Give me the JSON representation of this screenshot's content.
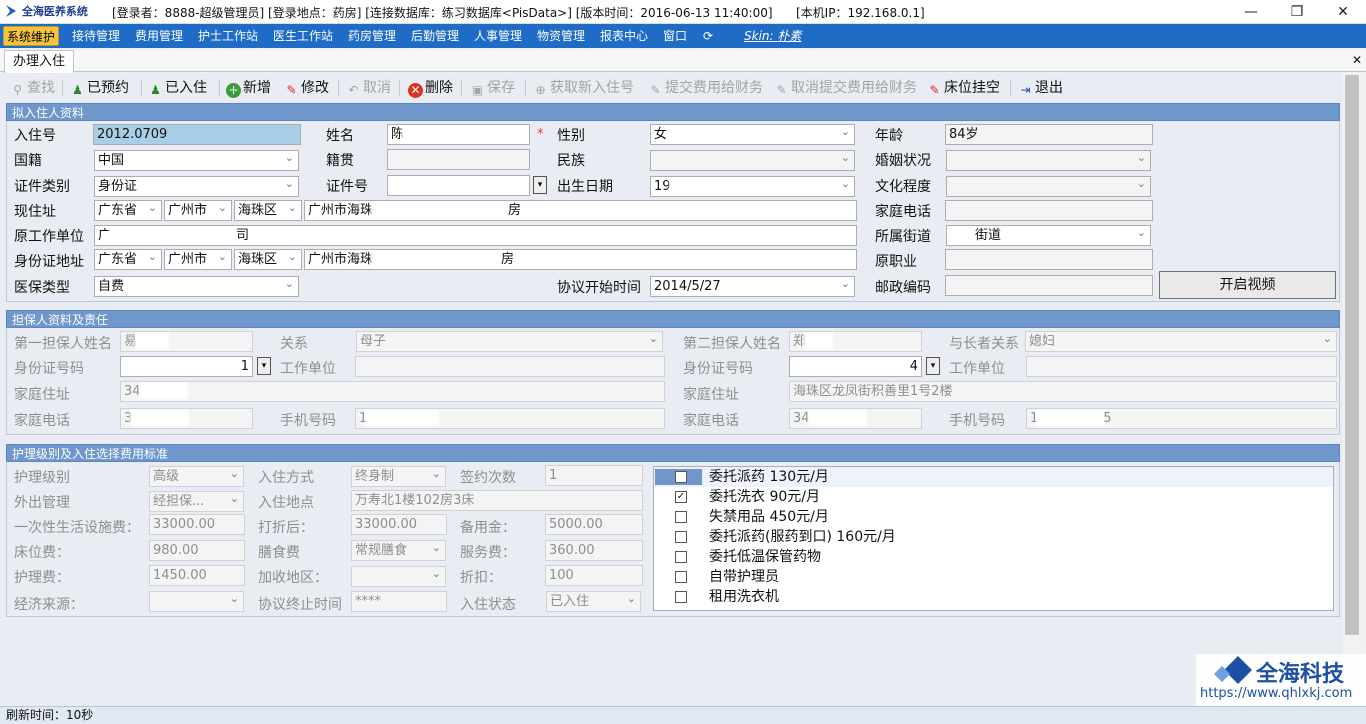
{
  "titlebar": {
    "app_name": "全海医养系统",
    "info": "[登录者：8888-超级管理员] [登录地点：药房] [连接数据库：练习数据库<PisData>] [版本时间：2016-06-13 11:40:00]",
    "ip": "[本机IP：192.168.0.1]",
    "minimize": "—",
    "restore": "❐",
    "close": "✕"
  },
  "menu": {
    "items": [
      "系统维护",
      "接待管理",
      "费用管理",
      "护士工作站",
      "医生工作站",
      "药房管理",
      "后勤管理",
      "人事管理",
      "物资管理",
      "报表中心",
      "窗口"
    ],
    "skin": "Skin: 朴素"
  },
  "tab": {
    "label": "办理入住",
    "close": "✕"
  },
  "toolbar": {
    "search": "查找",
    "reserved": "已预约",
    "checked_in": "已入住",
    "add": "新增",
    "edit": "修改",
    "cancel": "取消",
    "delete": "删除",
    "save": "保存",
    "get_new_no": "获取新入住号",
    "submit_fee": "提交费用给财务",
    "cancel_submit": "取消提交费用给财务",
    "bed_hang": "床位挂空",
    "exit": "退出"
  },
  "resident": {
    "header": "拟入住人资料",
    "labels": {
      "no": "入住号",
      "name": "姓名",
      "gender": "性别",
      "age": "年龄",
      "nationality": "国籍",
      "native": "籍贯",
      "ethnic": "民族",
      "marital": "婚姻状况",
      "idtype": "证件类别",
      "idno": "证件号",
      "birth": "出生日期",
      "education": "文化程度",
      "address": "现住址",
      "homephone": "家庭电话",
      "workunit": "原工作单位",
      "street": "所属街道",
      "idaddr": "身份证地址",
      "oldjob": "原职业",
      "insurance": "医保类型",
      "start": "协议开始时间",
      "zip": "邮政编码"
    },
    "values": {
      "no": "2012.0709",
      "name": "陈",
      "gender": "女",
      "age": "84岁",
      "nationality": "中国",
      "idtype": "身份证",
      "birth": "19",
      "prov": "广东省",
      "city": "广州市",
      "district": "海珠区",
      "addr": "广州市海珠",
      "addr_tail": "房",
      "workunit_a": "广",
      "workunit_b": "司",
      "street": "街道",
      "idprov": "广东省",
      "idcity": "广州市",
      "iddistrict": "海珠区",
      "idaddr": "广州市海珠",
      "idaddr_tail": "房",
      "insurance": "自费",
      "start": "2014/5/27"
    },
    "star": "*",
    "video_button": "开启视频"
  },
  "guarantor": {
    "header": "担保人资料及责任",
    "labels": {
      "name1": "第一担保人姓名",
      "relation1": "关系",
      "name2": "第二担保人姓名",
      "relation2": "与长者关系",
      "id1": "身份证号码",
      "work1": "工作单位",
      "id2": "身份证号码",
      "work2": "工作单位",
      "addr1": "家庭住址",
      "addr2": "家庭住址",
      "phone1": "家庭电话",
      "mobile1": "手机号码",
      "phone2": "家庭电话",
      "mobile2": "手机号码"
    },
    "values": {
      "name1": "易",
      "relation1": "母子",
      "name2": "郑",
      "relation2": "媳妇",
      "id1_tail": "1",
      "id2_tail": "4",
      "addr1": "34",
      "addr2": "海珠区龙凤街积善里1号2楼",
      "phone1": "3",
      "mobile1": "1",
      "phone2": "34",
      "mobile2": "1",
      "mobile2_tail": "5"
    }
  },
  "care": {
    "header": "护理级别及入住选择费用标准",
    "labels": {
      "level": "护理级别",
      "method": "入住方式",
      "sign_count": "签约次数",
      "outing": "外出管理",
      "location": "入住地点",
      "onetime": "一次性生活设施费：",
      "discounted": "打折后：",
      "reserve": "备用金：",
      "bed": "床位费：",
      "meal": "膳食费",
      "service": "服务费：",
      "care_fee": "护理费：",
      "region": "加收地区：",
      "discount": "折扣：",
      "econ": "经济来源：",
      "end": "协议终止时间",
      "status": "入住状态"
    },
    "values": {
      "level": "高级",
      "method": "终身制",
      "sign_count": "1",
      "outing": "经担保...",
      "location": "万寿北1楼102房3床",
      "onetime": "33000.00",
      "discounted": "33000.00",
      "reserve": "5000.00",
      "bed": "980.00",
      "meal": "常规膳食",
      "service": "360.00",
      "care_fee": "1450.00",
      "discount": "100",
      "end": "****",
      "status": "已入住"
    },
    "options": [
      {
        "label": "委托派药 130元/月",
        "checked": false
      },
      {
        "label": "委托洗衣 90元/月",
        "checked": true
      },
      {
        "label": "失禁用品 450元/月",
        "checked": false
      },
      {
        "label": "委托派药(服药到口) 160元/月",
        "checked": false
      },
      {
        "label": "委托低温保管药物",
        "checked": false
      },
      {
        "label": "自带护理员",
        "checked": false
      },
      {
        "label": "租用洗衣机",
        "checked": false
      }
    ]
  },
  "status": {
    "refresh": "刷新时间：10秒"
  },
  "watermark": {
    "title": "全海科技",
    "url": "https://www.qhlxkj.com"
  },
  "colors": {
    "menubar": "#1e6cc5",
    "section": "#6f97cc",
    "active_menu": "#f5c542"
  }
}
